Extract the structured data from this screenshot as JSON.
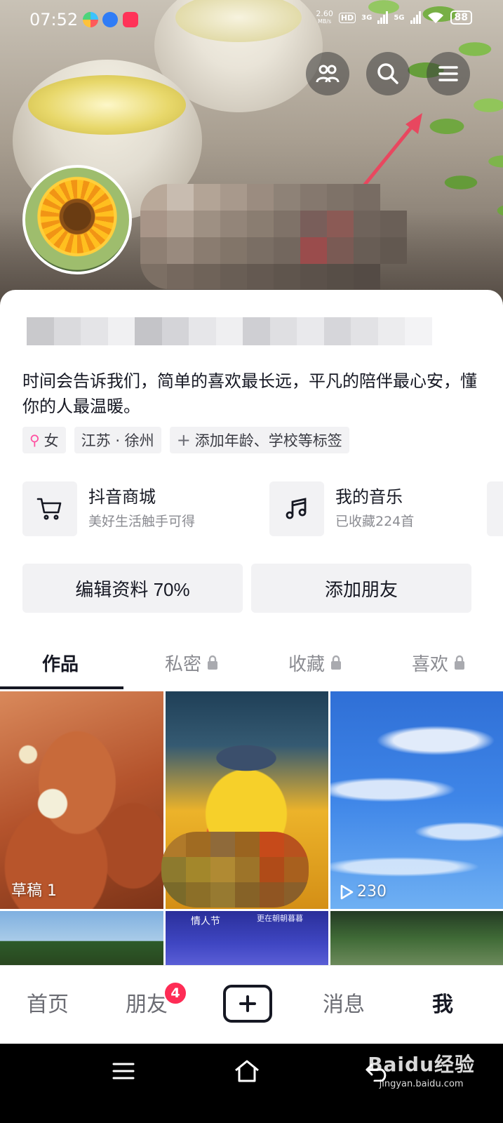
{
  "status_bar": {
    "time": "07:52",
    "net_speed_value": "2.60",
    "net_speed_unit": "MB/s",
    "hd_badge": "HD",
    "signal1_label": "3G",
    "signal2_label": "5G",
    "battery": "88"
  },
  "header": {
    "friends_icon": "friends-icon",
    "search_icon": "search-icon",
    "menu_icon": "menu-icon",
    "annotation_color": "#e8475f"
  },
  "profile": {
    "bio": "时间会告诉我们，简单的喜欢最长远，平凡的陪伴最心安，懂你的人最温暖。",
    "tags": {
      "gender": "女",
      "location": "江苏 · 徐州",
      "add_tags": "添加年龄、学校等标签"
    }
  },
  "services": {
    "shop": {
      "title": "抖音商城",
      "subtitle": "美好生活触手可得"
    },
    "music": {
      "title": "我的音乐",
      "subtitle": "已收藏224首"
    }
  },
  "actions": {
    "edit_profile": "编辑资料 70%",
    "add_friend": "添加朋友"
  },
  "tabs": {
    "works": "作品",
    "private": "私密",
    "favorites": "收藏",
    "likes": "喜欢"
  },
  "grid": {
    "draft_label": "草稿 1",
    "play_count": "230",
    "festival_title": "情人节",
    "festival_sub": "更在朝朝暮暮"
  },
  "bottom_nav": {
    "home": "首页",
    "friends": "朋友",
    "friends_badge": "4",
    "messages": "消息",
    "me": "我"
  },
  "watermark": {
    "brand": "Baidu经验",
    "url": "jingyan.baidu.com"
  },
  "colors": {
    "accent": "#fe2c55",
    "text_primary": "#161823",
    "text_secondary": "#8a8b91",
    "chip_bg": "#f2f2f4"
  }
}
